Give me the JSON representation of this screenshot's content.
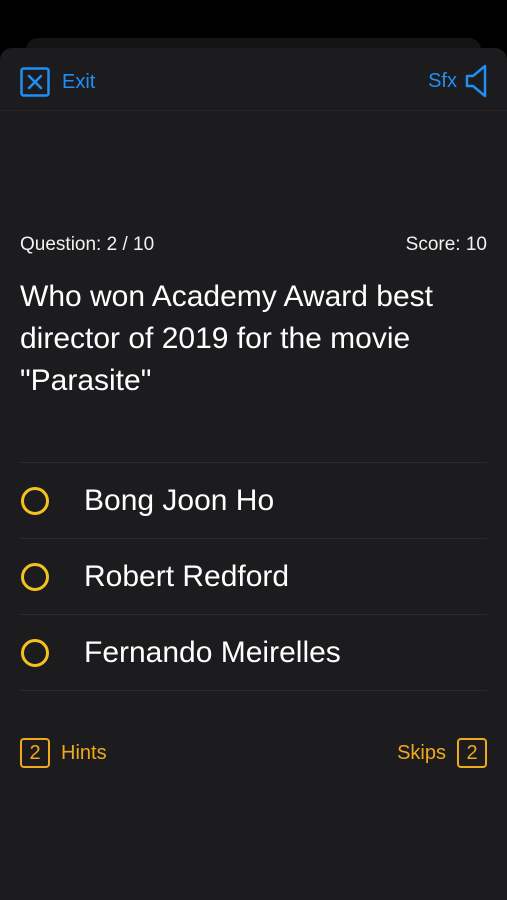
{
  "colors": {
    "accent_blue": "#1f8ff4",
    "accent_yellow": "#f4c21f",
    "accent_orange": "#f2a81d",
    "background": "#1c1c1e"
  },
  "topbar": {
    "exit_label": "Exit",
    "exit_icon": "close-square-icon",
    "sfx_label": "Sfx",
    "sfx_icon": "speaker-icon"
  },
  "quiz": {
    "question_label": "Question: 2 / 10",
    "score_label": "Score: 10",
    "question_text": "Who won Academy Award best director of 2019 for the movie \"Parasite\"",
    "options": [
      {
        "label": "Bong Joon Ho"
      },
      {
        "label": "Robert Redford"
      },
      {
        "label": "Fernando Meirelles"
      }
    ]
  },
  "footer": {
    "hints_count": "2",
    "hints_label": "Hints",
    "skips_label": "Skips",
    "skips_count": "2"
  }
}
